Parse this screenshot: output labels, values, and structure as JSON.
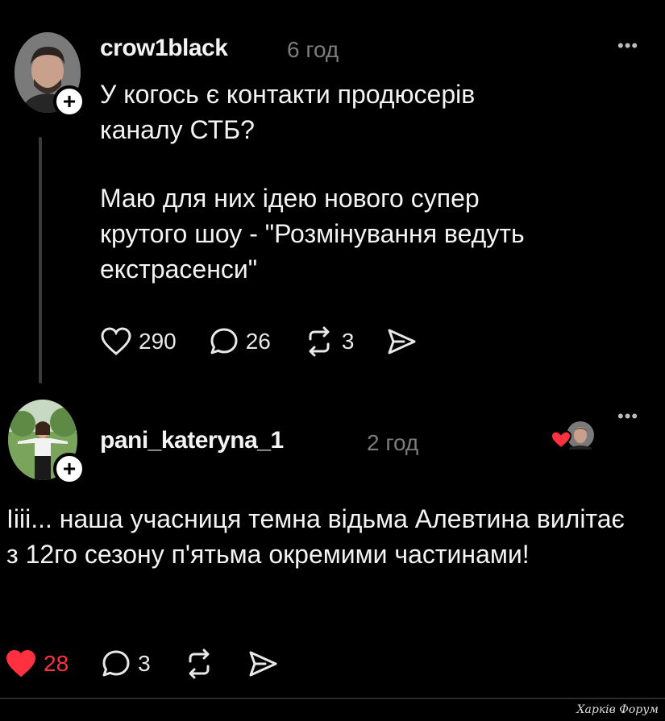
{
  "post1": {
    "username": "crow1black",
    "time": "6 год",
    "more_icon": "more-dots-icon",
    "paragraphs": [
      "У когось є контакти продюсерів каналу СТБ?",
      "Маю для них ідею нового супер крутого шоу - \"Розмінування ведуть екстрасенси\""
    ],
    "likes": "290",
    "comments": "26",
    "reposts": "3"
  },
  "post2": {
    "username": "pani_kateryna_1",
    "time": "2 год",
    "text": "Іііі... наша учасниця темна відьма Алевтина вилітає з 12го сезону п'ятьма окремими частинами!",
    "likes": "28",
    "comments": "3"
  },
  "watermark": "Харків Форум",
  "colors": {
    "background": "#000000",
    "like_active": "#ff3040",
    "muted": "#7c7c7c"
  }
}
